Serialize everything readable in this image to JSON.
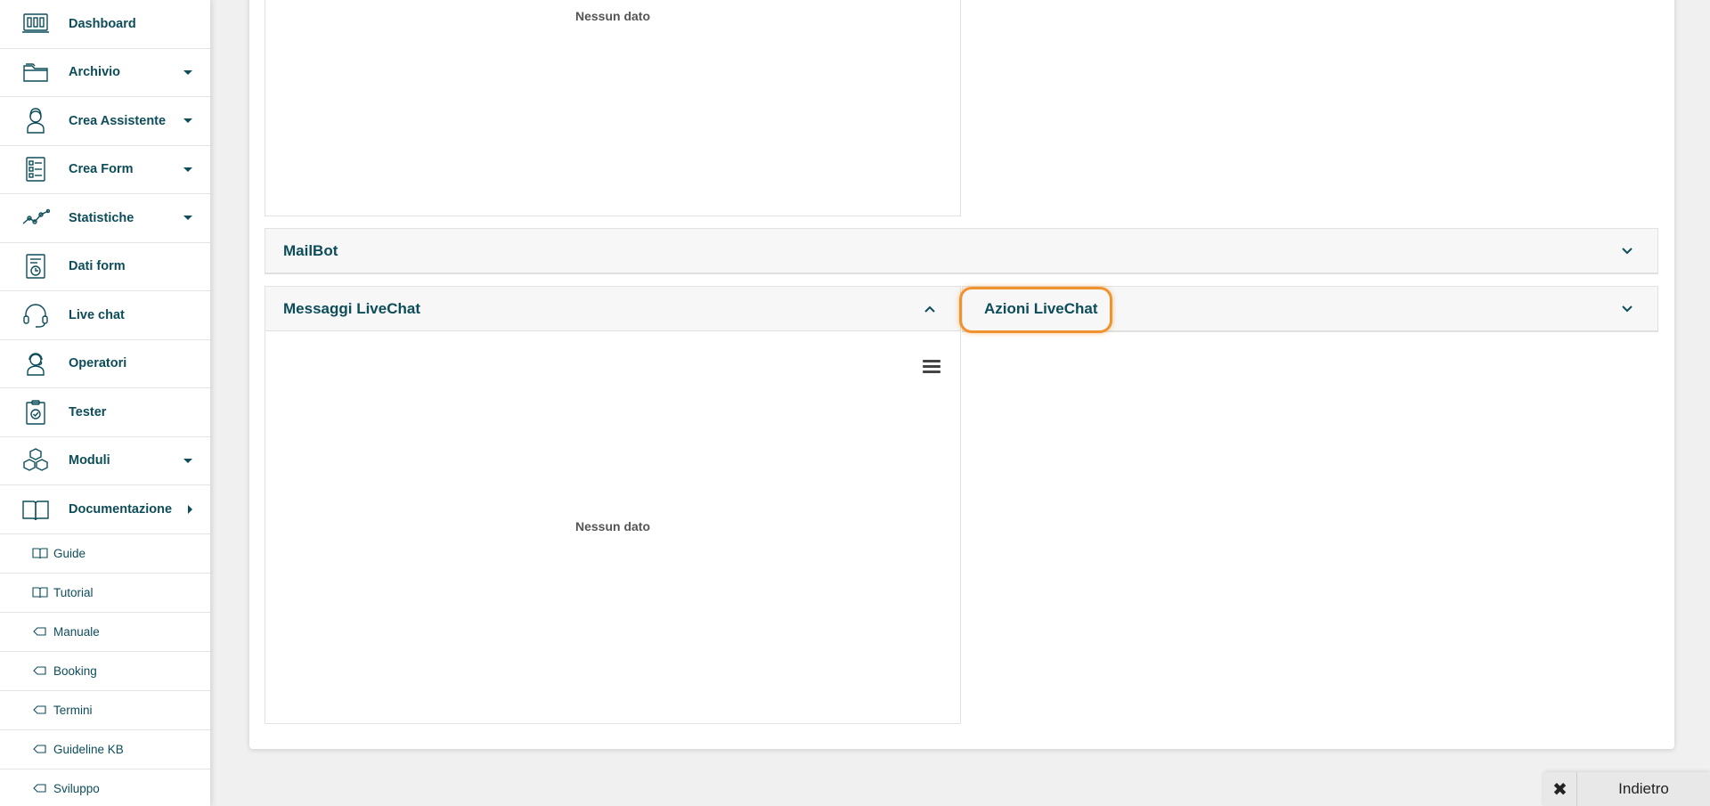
{
  "sidebar": {
    "items": [
      {
        "label": "Dashboard",
        "icon": "dashboard-icon"
      },
      {
        "label": "Archivio",
        "icon": "folder-icon"
      },
      {
        "label": "Crea Assistente",
        "icon": "assistant-icon"
      },
      {
        "label": "Crea Form",
        "icon": "form-icon"
      },
      {
        "label": "Statistiche",
        "icon": "statistics-icon"
      },
      {
        "label": "Dati form",
        "icon": "form-data-icon"
      },
      {
        "label": "Live chat",
        "icon": "headset-icon"
      },
      {
        "label": "Operatori",
        "icon": "operator-icon"
      },
      {
        "label": "Tester",
        "icon": "clipboard-check-icon"
      },
      {
        "label": "Moduli",
        "icon": "cubes-icon"
      },
      {
        "label": "Documentazione",
        "icon": "book-icon"
      }
    ],
    "subitems": [
      {
        "label": "Guide",
        "icon": "book-icon"
      },
      {
        "label": "Tutorial",
        "icon": "book-icon"
      },
      {
        "label": "Manuale",
        "icon": "tag-icon"
      },
      {
        "label": "Booking",
        "icon": "tag-icon"
      },
      {
        "label": "Termini",
        "icon": "tag-icon"
      },
      {
        "label": "Guideline KB",
        "icon": "tag-icon"
      },
      {
        "label": "Sviluppo",
        "icon": "tag-icon"
      }
    ]
  },
  "main": {
    "top_panel_empty": "Nessun dato",
    "mailbot_title": "MailBot",
    "messaggi_title": "Messaggi LiveChat",
    "azioni_title": "Azioni LiveChat",
    "messaggi_empty": "Nessun dato"
  },
  "bottom_bar": {
    "close_symbol": "✖",
    "back_label": "Indietro"
  },
  "colors": {
    "primary": "#0d4d5a",
    "highlight": "#f0922e",
    "background": "#f0f0f0"
  }
}
